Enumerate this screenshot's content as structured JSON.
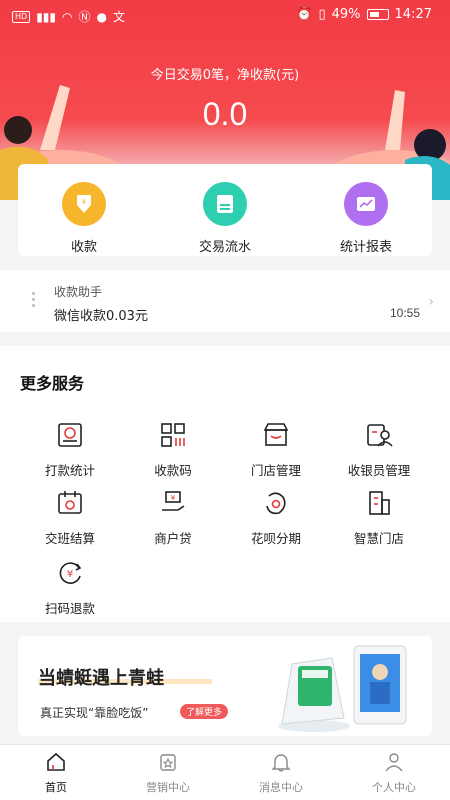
{
  "status_bar": {
    "network": "HD",
    "signal": "⁴⁶",
    "battery_pct": "49%",
    "time": "14:27"
  },
  "hero": {
    "label": "今日交易0笔，净收款(元)",
    "amount": "0.0"
  },
  "quick_actions": [
    {
      "label": "收款",
      "icon": "yen-down-icon",
      "color": "#f7b52b"
    },
    {
      "label": "交易流水",
      "icon": "receipt-icon",
      "color": "#2dcfb0"
    },
    {
      "label": "统计报表",
      "icon": "report-chart-icon",
      "color": "#b06ef0"
    }
  ],
  "helper": {
    "title": "收款助手",
    "message": "微信收款0.03元",
    "time": "10:55"
  },
  "services": {
    "title": "更多服务",
    "items": [
      {
        "label": "打款统计",
        "icon": "payout-stats-icon"
      },
      {
        "label": "收款码",
        "icon": "qr-code-icon"
      },
      {
        "label": "门店管理",
        "icon": "store-icon"
      },
      {
        "label": "收银员管理",
        "icon": "cashier-user-icon"
      },
      {
        "label": "交班结算",
        "icon": "shift-calendar-icon"
      },
      {
        "label": "商户贷",
        "icon": "loan-hand-icon"
      },
      {
        "label": "花呗分期",
        "icon": "huabei-icon"
      },
      {
        "label": "智慧门店",
        "icon": "smart-building-icon"
      },
      {
        "label": "扫码退款",
        "icon": "scan-refund-icon"
      }
    ]
  },
  "banner": {
    "title": "当蜻蜓遇上青蛙",
    "subtitle": "真正实现“靠脸吃饭”",
    "button": "了解更多"
  },
  "tabbar": [
    {
      "label": "首页",
      "active": true,
      "icon": "home-icon"
    },
    {
      "label": "营销中心",
      "active": false,
      "icon": "star-bag-icon"
    },
    {
      "label": "消息中心",
      "active": false,
      "icon": "bell-icon"
    },
    {
      "label": "个人中心",
      "active": false,
      "icon": "person-icon"
    }
  ],
  "colors": {
    "brand_red": "#f23b45",
    "accent": "#f05a5a"
  }
}
